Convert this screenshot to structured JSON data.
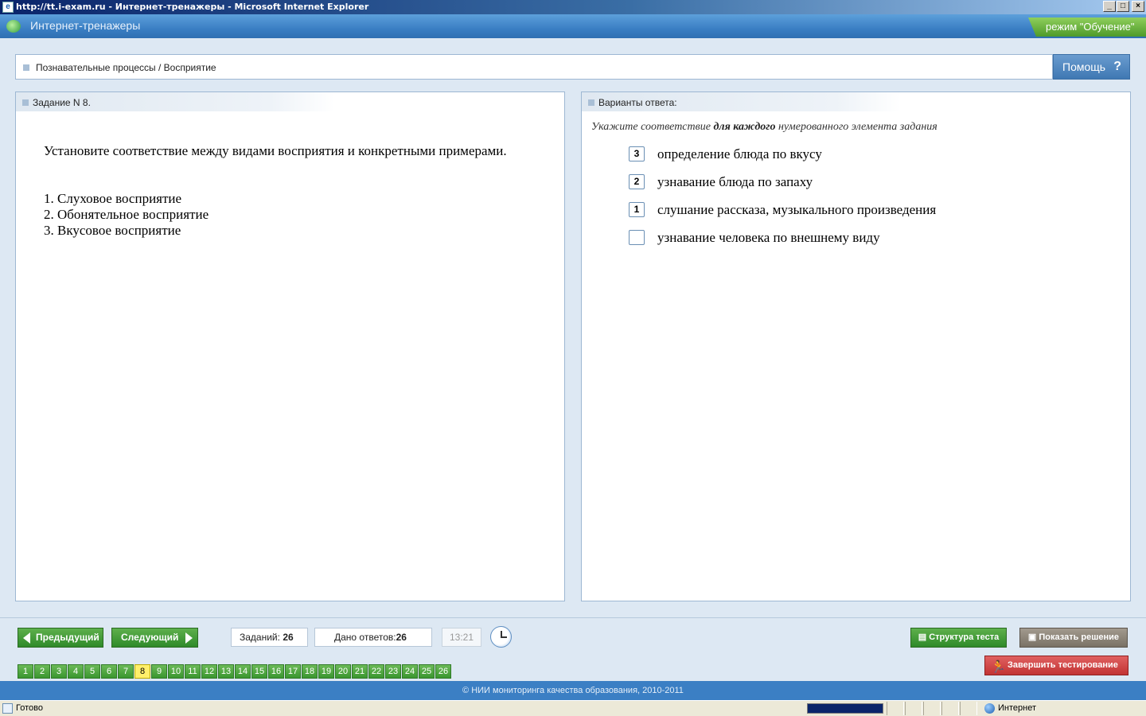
{
  "window": {
    "title": "http://tt.i-exam.ru - Интернет-тренажеры - Microsoft Internet Explorer",
    "buttons": [
      "_",
      "□",
      "×"
    ]
  },
  "header": {
    "app_title": "Интернет-тренажеры",
    "mode": "режим \"Обучение\""
  },
  "breadcrumb": "Познавательные процессы / Восприятие",
  "help_label": "Помощь",
  "task": {
    "heading": "Задание N 8.",
    "question": "Установите соответствие между видами восприятия  и конкретными примерами.",
    "items": [
      "1. Слуховое восприятие",
      "2. Обонятельное восприятие",
      "3. Вкусовое восприятие"
    ]
  },
  "answers": {
    "heading": "Варианты ответа:",
    "instruction_pre": "Укажите соответствие ",
    "instruction_bold": "для каждого",
    "instruction_post": " нумерованного элемента задания",
    "options": [
      {
        "value": "3",
        "text": "определение блюда по вкусу"
      },
      {
        "value": "2",
        "text": "узнавание блюда по запаху"
      },
      {
        "value": "1",
        "text": "слушание рассказа, музыкального произведения"
      },
      {
        "value": "",
        "text": "узнавание человека по внешнему виду"
      }
    ]
  },
  "nav": {
    "prev": "Предыдущий",
    "next": "Следующий",
    "tasks_label": "Заданий:",
    "tasks_count": "26",
    "answered_label": "Дано ответов:",
    "answered_count": "26",
    "time": "13:21",
    "structure": "Структура теста",
    "show_solution": "Показать решение",
    "finish": "Завершить тестирование",
    "pages": [
      "1",
      "2",
      "3",
      "4",
      "5",
      "6",
      "7",
      "8",
      "9",
      "10",
      "11",
      "12",
      "13",
      "14",
      "15",
      "16",
      "17",
      "18",
      "19",
      "20",
      "21",
      "22",
      "23",
      "24",
      "25",
      "26"
    ],
    "current_page": "8"
  },
  "footer": "© НИИ мониторинга качества образования, 2010-2011",
  "statusbar": {
    "status": "Готово",
    "zone": "Интернет"
  }
}
